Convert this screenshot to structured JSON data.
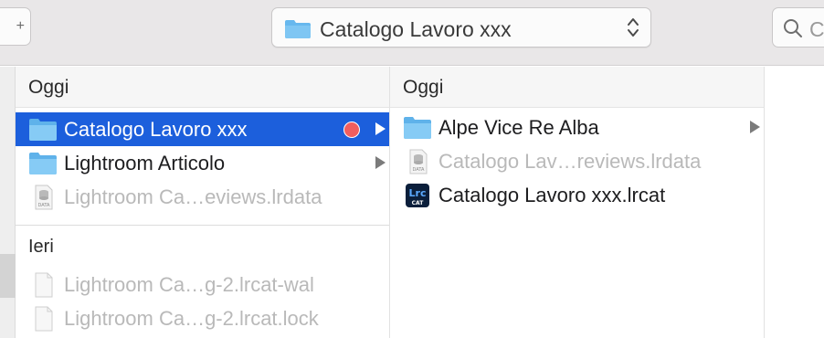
{
  "toolbar": {
    "path_label": "Catalogo Lavoro xxx",
    "search_placeholder": "Cerca"
  },
  "column1": {
    "header": "Oggi",
    "items": [
      {
        "name": "Catalogo Lavoro xxx",
        "kind": "folder",
        "selected": true,
        "tag_color": "#f15e5e",
        "has_children": true
      },
      {
        "name": "Lightroom Articolo",
        "kind": "folder",
        "selected": false,
        "has_children": true
      },
      {
        "name": "Lightroom Ca…eviews.lrdata",
        "kind": "lrdata",
        "dimmed": true
      }
    ],
    "section2_label": "Ieri",
    "section2_items": [
      {
        "name": "Lightroom Ca…g-2.lrcat-wal",
        "kind": "document",
        "dimmed": true
      },
      {
        "name": "Lightroom Ca…g-2.lrcat.lock",
        "kind": "document",
        "dimmed": true
      }
    ]
  },
  "column2": {
    "header": "Oggi",
    "items": [
      {
        "name": "Alpe Vice Re Alba",
        "kind": "folder",
        "has_children": true
      },
      {
        "name": "Catalogo Lav…reviews.lrdata",
        "kind": "lrdata",
        "dimmed": true
      },
      {
        "name": "Catalogo Lavoro xxx.lrcat",
        "kind": "lrcat",
        "badge_top": "Lrc",
        "badge_bottom": "CAT"
      }
    ]
  },
  "colors": {
    "selection": "#1c5fdc",
    "folder": "#67b8ee",
    "tag_red": "#f15e5e",
    "lrc_badge": "#0b1f3b",
    "lrc_text": "#5aa9ff"
  }
}
